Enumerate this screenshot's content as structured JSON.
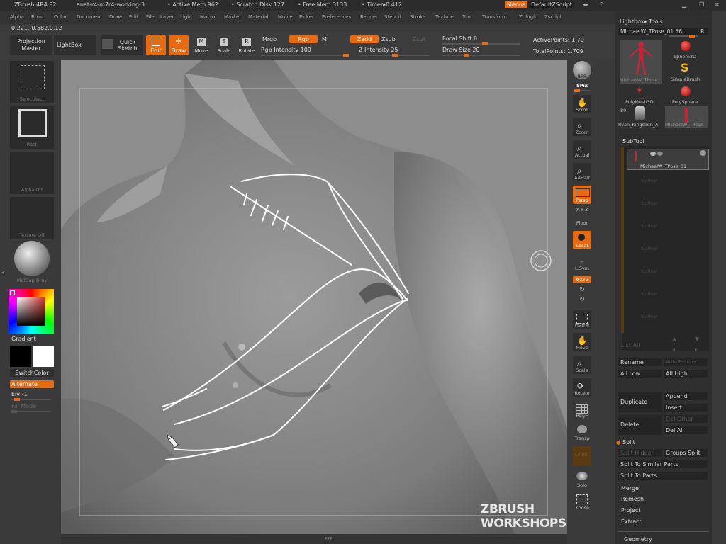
{
  "titlebar": {
    "app": "ZBrush 4R4 P2",
    "file": "anat-r4-m7r4-working-3",
    "active_mem": "• Active Mem 962",
    "scratch": "• Scratch Disk 127",
    "free_mem": "• Free Mem 3133",
    "timer": "• Timer▸0.412",
    "menus_button": "Menus",
    "script": "DefaultZScript"
  },
  "menubar": [
    "Alpha",
    "Brush",
    "Color",
    "Document",
    "Draw",
    "Edit",
    "File",
    "Layer",
    "Light",
    "Macro",
    "Marker",
    "Material",
    "Movie",
    "Picker",
    "Preferences",
    "Render",
    "Stencil",
    "Stroke",
    "Texture",
    "Tool",
    "Transform",
    "Zplugin",
    "Zscript"
  ],
  "coords": "0.221,-0.582,0.12",
  "toolbar": {
    "projection_master": "Projection Master",
    "lightbox": "LightBox",
    "quick_sketch": "Quick Sketch",
    "edit": "Edit",
    "draw": "Draw",
    "move": "Move",
    "scale": "Scale",
    "rotate": "Rotate",
    "mrgb": "Mrgb",
    "rgb": "Rgb",
    "m": "M",
    "rgb_intensity": "Rgb Intensity 100",
    "rgb_intensity_value": 100,
    "zadd": "Zadd",
    "zsub": "Zsub",
    "zcut": "Zcut",
    "z_intensity": "Z Intensity 25",
    "z_intensity_value": 25,
    "focal_shift": "Focal Shift 0",
    "draw_size": "Draw Size 20",
    "active_points": "ActivePoints: 1.70",
    "total_points": "TotalPoints: 1.709"
  },
  "left_shelf": {
    "select_rect": "SelectRect",
    "rect": "Rect",
    "alpha_off": "Alpha Off",
    "texture_off": "Texture Off",
    "matcap": "MatCap Gray",
    "gradient": "Gradient",
    "switch_color": "SwitchColor",
    "alternate": "Alternate",
    "elv": "Elv -1",
    "fill_mode": "Fill Mode"
  },
  "right_shelf": {
    "bpr": "BPR",
    "spix": "SPix",
    "scroll": "Scroll",
    "zoom": "Zoom",
    "actual": "Actual",
    "aahalf": "AAHalf",
    "persp": "Persp",
    "floor_axes": "X Y Z",
    "floor": "Floor",
    "local": "Local",
    "lsym": "L.Sym",
    "xyz": "❖XYZ",
    "frame": "Frame",
    "move": "Move",
    "scale": "Scale",
    "rotate": "Rotate",
    "polyf": "PolyF",
    "transp": "Transp",
    "ghost": "Ghost",
    "solo": "Solo",
    "xpose": "Xpose"
  },
  "tool_panel": {
    "header": "Lightbox▸ Tools",
    "current_tool": "MichaelW_TPose_01.56",
    "r_button": "R",
    "tools": [
      "MichaelW_TPose",
      "Sphere3D",
      "SimpleBrush",
      "PolyMesh3D",
      "PolySphere",
      "Ryan_Kingslien_A",
      "MichaelW_TPose"
    ],
    "count": "89",
    "subtool_header": "SubTool",
    "subtool_item": "MichaelW_TPose_01",
    "empty_slot": "Subtool",
    "list_all": "List All",
    "rename": "Rename",
    "auto_reorder": "AutoReorder",
    "all_low": "All Low",
    "all_high": "All High",
    "duplicate": "Duplicate",
    "append": "Append",
    "insert": "Insert",
    "delete": "Delete",
    "del_other": "Del Other",
    "del_all": "Del All",
    "split": "Split",
    "split_hidden": "Split Hidden",
    "groups_split": "Groups Split",
    "split_similar": "Split To Similar Parts",
    "split_parts": "Split To Parts",
    "merge": "Merge",
    "remesh": "Remesh",
    "project": "Project",
    "extract": "Extract",
    "geometry": "Geometry"
  },
  "watermark": "ZBRUSH WORKSHOPS",
  "colors": {
    "accent": "#e86a10",
    "panel": "#2f2f2f",
    "canvas": "#8d8d8d"
  }
}
